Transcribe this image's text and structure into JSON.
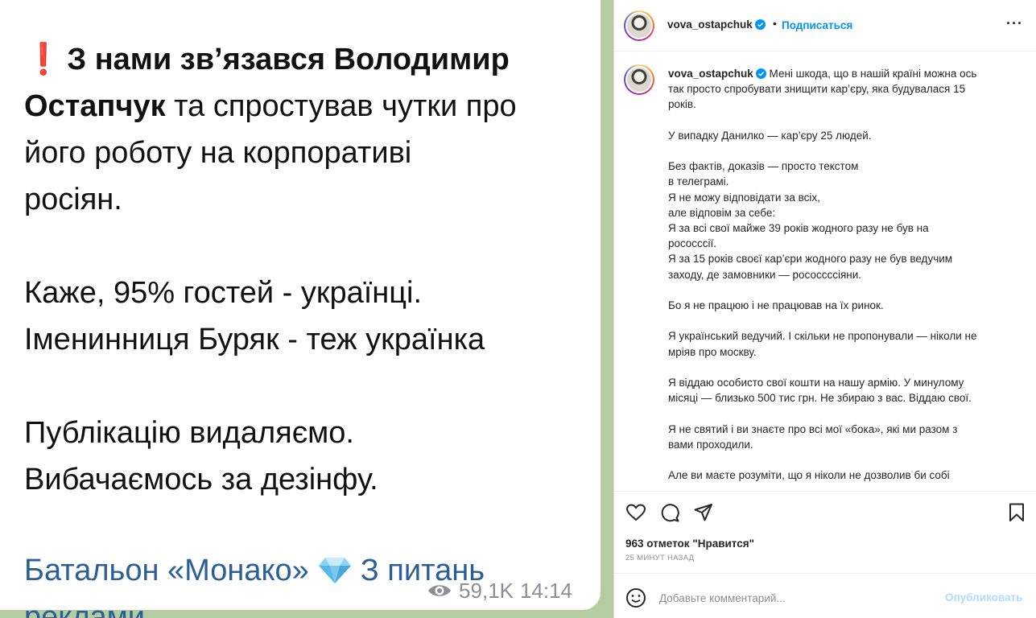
{
  "telegram": {
    "line1_bold": "З нами зв’язався Володимир",
    "line2_bold": "Остапчук",
    "line2_rest": " та спростував чутки про",
    "line3": "його роботу на корпоративі",
    "line4": "росіян.",
    "para2_line1": "Каже, 95% гостей - українці.",
    "para2_line2": "Іменинниця Буряк - теж українка",
    "para3_line1": "Публікацію видаляємо.",
    "para3_line2": "Вибачаємось за дезінфу.",
    "link1": "Батальон «Монако»",
    "link2": "З питань",
    "link3": "реклами",
    "views": "59,1K",
    "time": "14:14",
    "icons": {
      "alert": "exclamation-icon",
      "diamond": "diamond-icon",
      "views": "eye-icon"
    },
    "colors": {
      "alert": "#d2141c",
      "link": "#2a5f9a",
      "meta": "#8a8f94",
      "background": "#b3cca0"
    }
  },
  "instagram": {
    "header": {
      "username": "vova_ostapchuk",
      "separator": "•",
      "follow_label": "Подписаться",
      "more_label": "···"
    },
    "caption": {
      "username": "vova_ostapchuk",
      "first_line": " Мені шкода, що в нашій країні можна ось",
      "lines": [
        "так просто спробувати знищити кар’єру, яка будувалася 15",
        "років.",
        "",
        "У випадку Данилко — кар’єру 25 людей.",
        "",
        "Без фактів, доказів — просто текстом",
        "в телеграмі.",
        "Я не можу відповідати за всіх,",
        "але відповім за себе:",
        "Я за всі свої майже 39 років жодного разу не був на",
        "роcосссії.",
        "Я за 15 років своєї кар’єри жодного разу не був ведучим",
        "заходу, де замовники — рососсссіяни.",
        "",
        "Бо я не працюю і не працював на їх ринок.",
        "",
        "Я український ведучий. І скільки не пропонували — ніколи не",
        "мріяв про москву.",
        "",
        "Я віддаю особисто свої кошти на нашу армію. У минулому",
        "місяці — близько 500 тис грн. Не збираю з вас. Віддаю свої.",
        "",
        "Я не святий і ви знаєте про всі мої «бока», які ми разом з",
        "вами проходили.",
        "",
        "Але ви маєте розуміти, що я ніколи не дозволив би собі"
      ]
    },
    "likes": "963 отметок \"Нравится\"",
    "time_ago": "25 минут назад",
    "comment": {
      "placeholder": "Добавьте комментарий...",
      "post_label": "Опубликовать"
    },
    "icons": {
      "like": "heart-icon",
      "comment": "comment-icon",
      "share": "send-icon",
      "save": "bookmark-icon",
      "emoji": "emoji-icon",
      "verified": "verified-icon"
    },
    "colors": {
      "follow": "#0095f6",
      "post_disabled": "#b3dbff",
      "secondary": "#8e8e8e"
    }
  }
}
